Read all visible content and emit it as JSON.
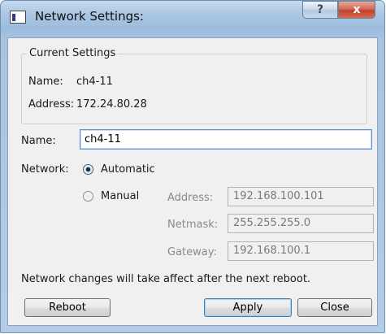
{
  "window": {
    "title": "Network Settings:",
    "help_label": "?",
    "close_label": "x"
  },
  "current": {
    "group_title": "Current Settings",
    "name_label": "Name:",
    "name_value": "ch4-11",
    "address_label": "Address:",
    "address_value": "172.24.80.28"
  },
  "form": {
    "name_label": "Name:",
    "name_value": "ch4-11",
    "network_label": "Network:",
    "automatic_label": "Automatic",
    "manual_label": "Manual",
    "selected_mode": "Automatic",
    "address_label": "Address:",
    "address_value": "192.168.100.101",
    "netmask_label": "Netmask:",
    "netmask_value": "255.255.255.0",
    "gateway_label": "Gateway:",
    "gateway_value": "192.168.100.1"
  },
  "notice": "Network changes will take affect after the next reboot.",
  "buttons": {
    "reboot": "Reboot",
    "apply": "Apply",
    "close": "Close"
  }
}
